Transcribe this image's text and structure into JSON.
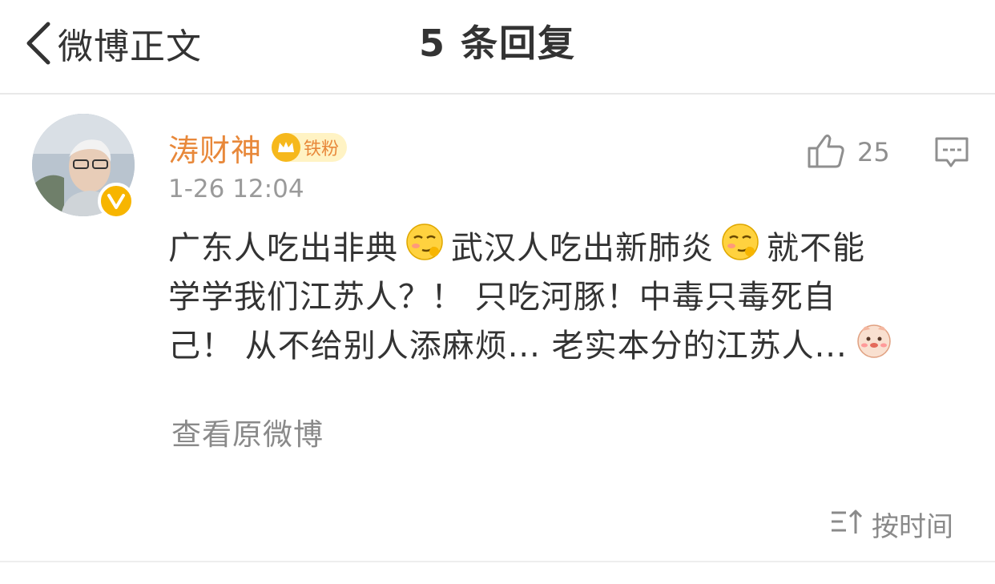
{
  "header": {
    "back_label": "微博正文",
    "title": "5 条回复"
  },
  "comment": {
    "username": "涛财神",
    "fan_badge": "铁粉",
    "timestamp": "1-26 12:04",
    "like_count": "25",
    "text_lines": {
      "l1a": "广东人吃出非典",
      "l1b": "武汉人吃出新肺炎",
      "l1c": "就不能",
      "l2": "学学我们江苏人？！ 只吃河豚！中毒只毒死自",
      "l3": "己！ 从不给别人添麻烦... 老实本分的江苏人..."
    },
    "view_original": "查看原微博"
  },
  "sort": {
    "label": "按时间"
  },
  "colors": {
    "username": "#e8883a",
    "badge_gold": "#f6b81c",
    "muted": "#8a8a8a",
    "text": "#333333"
  }
}
